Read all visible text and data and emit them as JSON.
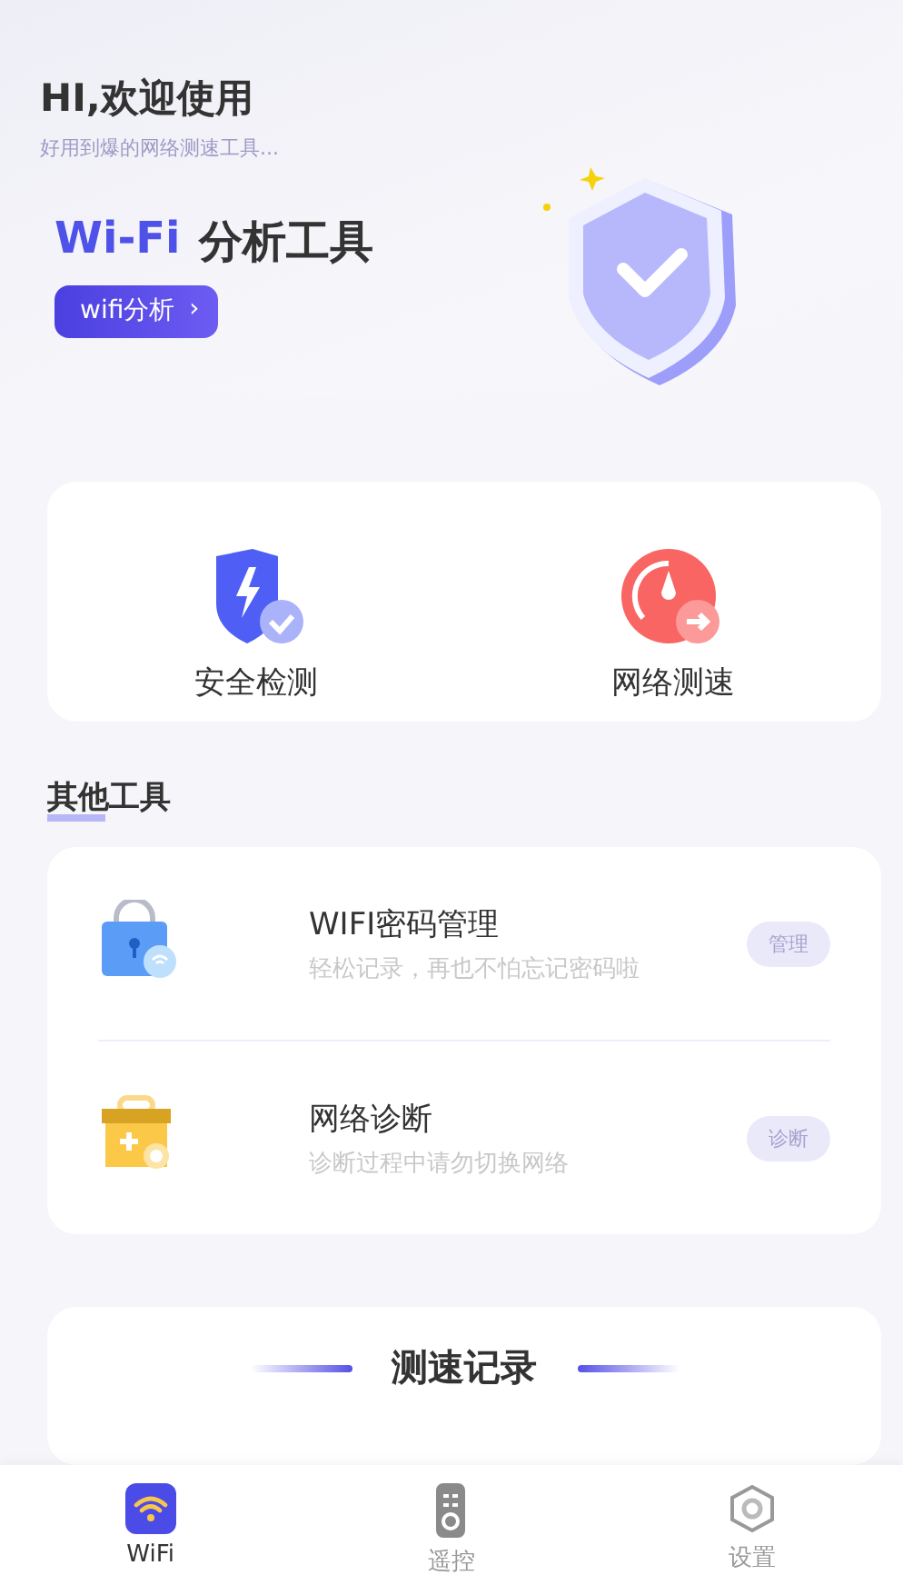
{
  "header": {
    "greeting": "HI,欢迎使用",
    "subtitle": "好用到爆的网络测速工具...",
    "title_highlight": "Wi-Fi",
    "title_rest": "分析工具",
    "button": "wifi分析",
    "button_arrow": "›"
  },
  "quick_actions": [
    {
      "kind": "shield",
      "label": "安全检测"
    },
    {
      "kind": "speedometer",
      "label": "网络测速"
    }
  ],
  "other_tools": {
    "title": "其他工具",
    "items": [
      {
        "kind": "lock",
        "name": "WIFI密码管理",
        "description": "轻松记录，再也不怕忘记密码啦",
        "action": "管理"
      },
      {
        "kind": "toolbox",
        "name": "网络诊断",
        "description": "诊断过程中请勿切换网络",
        "action": "诊断"
      }
    ]
  },
  "speed_records": {
    "title": "测速记录"
  },
  "tabs": [
    {
      "kind": "wifi",
      "label": "WiFi",
      "selected": true
    },
    {
      "kind": "remote",
      "label": "遥控",
      "selected": false
    },
    {
      "kind": "settings",
      "label": "设置",
      "selected": false
    }
  ]
}
